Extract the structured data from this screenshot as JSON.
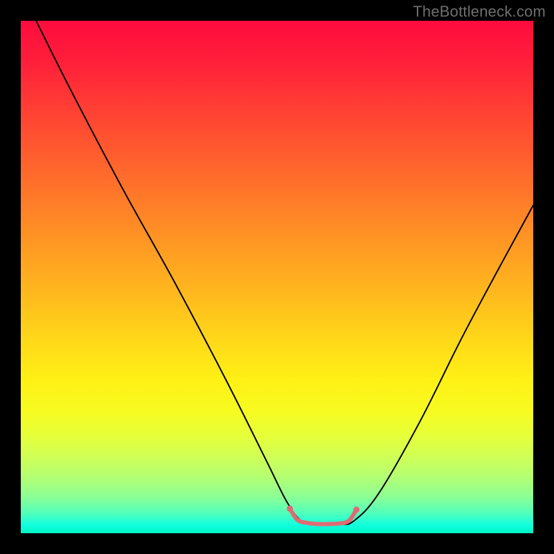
{
  "watermark": "TheBottleneck.com",
  "chart_data": {
    "type": "line",
    "title": "",
    "xlabel": "",
    "ylabel": "",
    "xlim": [
      0,
      100
    ],
    "ylim": [
      0,
      100
    ],
    "grid": false,
    "legend": false,
    "background": "rainbow-vertical-gradient",
    "series": [
      {
        "name": "black-curve",
        "stroke": "#000000",
        "stroke_width": 2,
        "x": [
          3,
          10,
          20,
          30,
          40,
          48,
          52,
          55,
          58,
          62,
          65,
          70,
          78,
          86,
          94,
          100
        ],
        "values": [
          100,
          86,
          67,
          49,
          30,
          14,
          6,
          2.2,
          1.8,
          1.8,
          2.4,
          8,
          22,
          38,
          53,
          64
        ]
      },
      {
        "name": "pink-curve-floor",
        "stroke": "#e06a74",
        "stroke_width": 6,
        "x": [
          52.5,
          54,
          56,
          58,
          60,
          62,
          64,
          65.5
        ],
        "values": [
          4.8,
          2.6,
          2.0,
          1.8,
          1.8,
          1.9,
          2.4,
          4.6
        ]
      }
    ],
    "notes": "Axes unlabeled in source; values are read in percent of plot width/height. y=0 at bottom. Pink segment traces the floor of the V near x≈53..66."
  }
}
